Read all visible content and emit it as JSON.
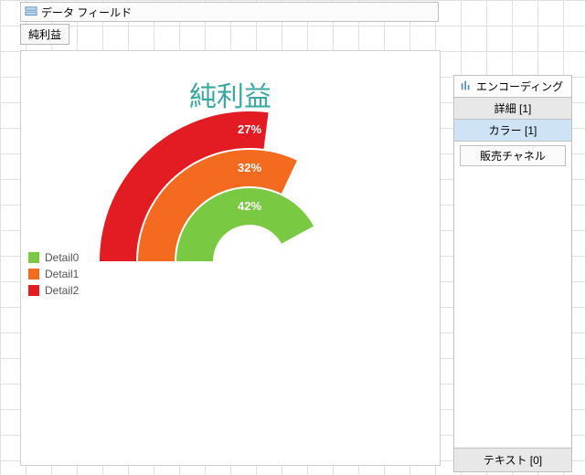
{
  "data_fields": {
    "label": "データ フィールド",
    "chip": "純利益"
  },
  "chart_data": {
    "type": "bar",
    "title": "純利益",
    "series": [
      {
        "name": "Detail0",
        "value": 42,
        "color": "#7AC943",
        "label": "42%"
      },
      {
        "name": "Detail1",
        "value": 32,
        "color": "#F46A1F",
        "label": "32%"
      },
      {
        "name": "Detail2",
        "value": 27,
        "color": "#E31B23",
        "label": "27%"
      }
    ],
    "value_unit": "percent",
    "range": [
      0,
      100
    ],
    "shape": "radial-bar"
  },
  "encoding": {
    "header": "エンコーディング",
    "rows": {
      "details": "詳細 [1]",
      "color": "カラー [1]"
    },
    "chip": "販売チャネル",
    "footer": "テキスト [0]"
  }
}
